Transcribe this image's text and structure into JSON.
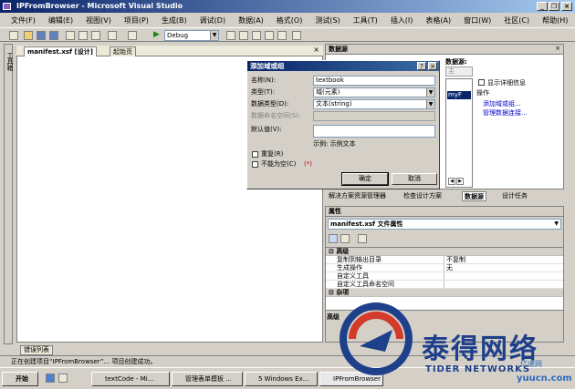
{
  "window": {
    "title": "IPFromBrowser - Microsoft Visual Studio",
    "min": "_",
    "max": "❐",
    "close": "×"
  },
  "menu": [
    "文件(F)",
    "编辑(E)",
    "视图(V)",
    "项目(P)",
    "生成(B)",
    "调试(D)",
    "数据(A)",
    "格式(O)",
    "测试(S)",
    "工具(T)",
    "插入(I)",
    "表格(A)",
    "窗口(W)",
    "社区(C)",
    "帮助(H)"
  ],
  "toolbar": {
    "config": "Debug",
    "play": "▶"
  },
  "left_tab": "工具箱",
  "editor": {
    "tabs": [
      "manifest.xsf [设计]",
      "起始页"
    ],
    "close": "×"
  },
  "datasource": {
    "title": "数据源",
    "header": "数据源:",
    "main_label": "主",
    "selected": "myF",
    "show_details": "显示详细信息",
    "ops_title": "操作",
    "links": [
      "添加域或组...",
      "管理数据连接..."
    ]
  },
  "dialog": {
    "title": "添加域或组",
    "help": "?",
    "close": "×",
    "labels": [
      "名称(N):",
      "类型(T):",
      "数据类型(D):",
      "数据命名空间(S):",
      "默认值(V):"
    ],
    "name_value": "textbook",
    "type_value": "域(元素)",
    "datatype_value": "文本(string)",
    "example": "示例: 示例文本",
    "repeat": "重复(R)",
    "nonempty": "不能为空(C)",
    "required_mark": "(*)",
    "ok": "确定",
    "cancel": "取消"
  },
  "task_tabs": [
    "解决方案资源管理器",
    "检查设计方案",
    "数据源",
    "设计任务"
  ],
  "properties": {
    "title": "属性",
    "object": "manifest.xsf 文件属性",
    "cat1": "高级",
    "rows": [
      {
        "k": "复制到输出目录",
        "v": "不复制"
      },
      {
        "k": "生成操作",
        "v": "无"
      },
      {
        "k": "自定义工具",
        "v": ""
      },
      {
        "k": "自定义工具命名空间",
        "v": ""
      }
    ],
    "cat2": "杂项",
    "desc": "高级"
  },
  "errors_tab": "错误列表",
  "status": "正在创建项目“IPFromBrowser”... 项目创建成功。",
  "taskbar": {
    "start": "开始",
    "items": [
      "textCode - Mi...",
      "管理表单模板 ...",
      "5 Windows Ex...",
      "IPFromBrowser"
    ]
  },
  "watermark": {
    "brand": "泰得网络",
    "sub": "TIDER NETWORKS",
    "site": "yuucn.com",
    "site2": "亿速网"
  },
  "colors": {
    "title_start": "#0a246a",
    "title_end": "#a6caf0",
    "link": "#0000cc",
    "required": "#cc0000",
    "watermark": "#1e3f8a"
  }
}
